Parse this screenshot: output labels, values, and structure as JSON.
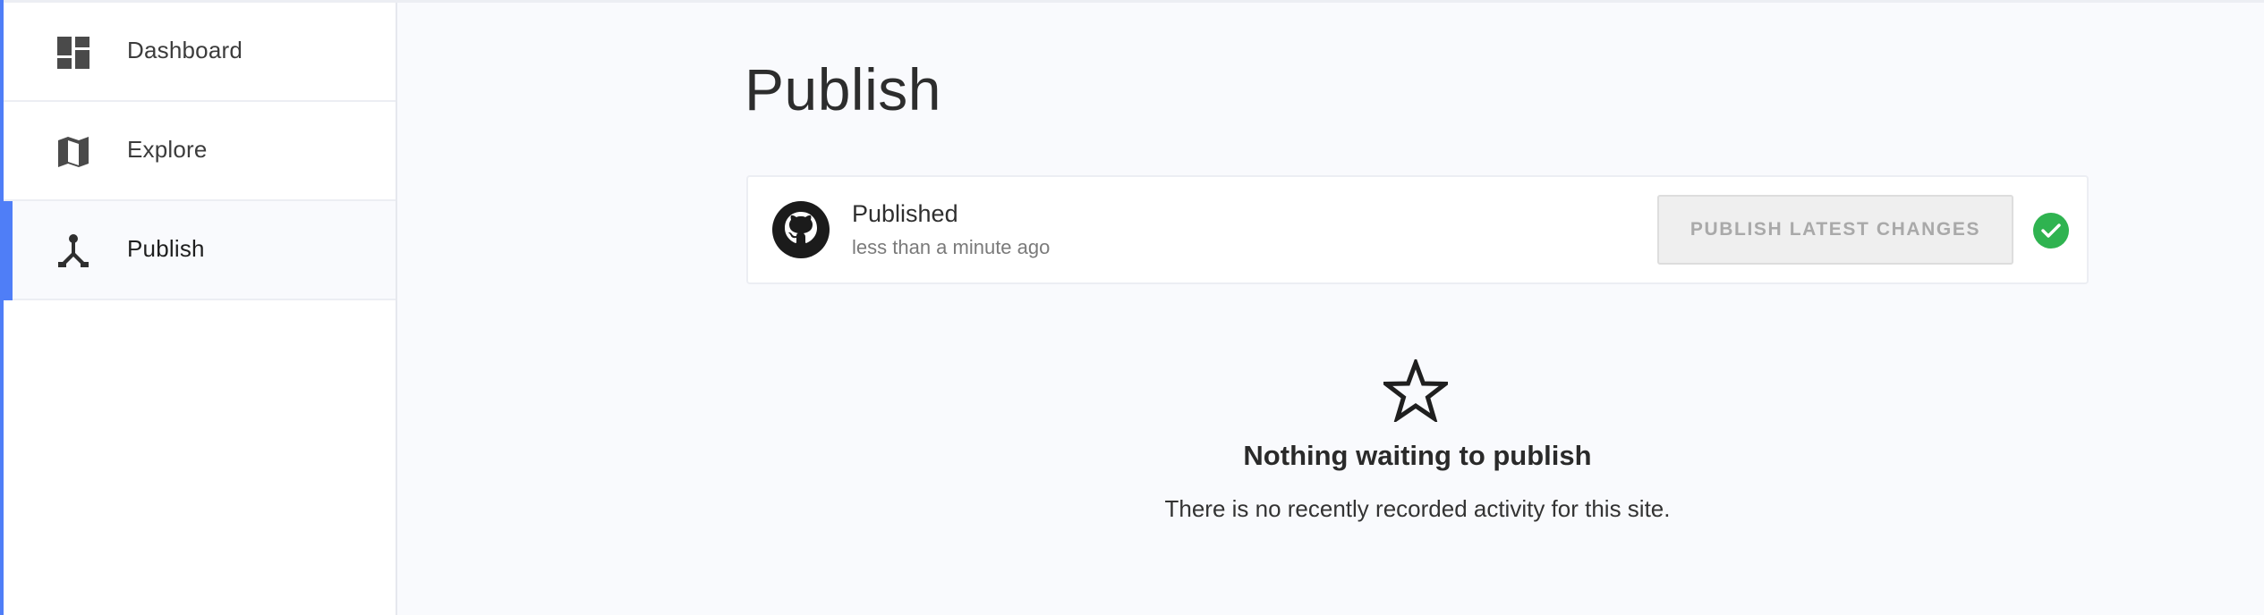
{
  "sidebar": {
    "items": [
      {
        "label": "Dashboard",
        "icon": "dashboard-icon",
        "active": false
      },
      {
        "label": "Explore",
        "icon": "map-icon",
        "active": false
      },
      {
        "label": "Publish",
        "icon": "publish-fork-icon",
        "active": true
      }
    ]
  },
  "main": {
    "title": "Publish",
    "status": {
      "title": "Published",
      "time": "less than a minute ago",
      "button_label": "PUBLISH LATEST CHANGES",
      "logo_icon": "github-icon",
      "check_icon": "check-circle-icon"
    },
    "empty": {
      "icon": "star-icon",
      "title": "Nothing waiting to publish",
      "description": "There is no recently recorded activity for this site."
    }
  },
  "colors": {
    "accent": "#4f7ef7",
    "success": "#2fb350",
    "background": "#f9fafd"
  }
}
